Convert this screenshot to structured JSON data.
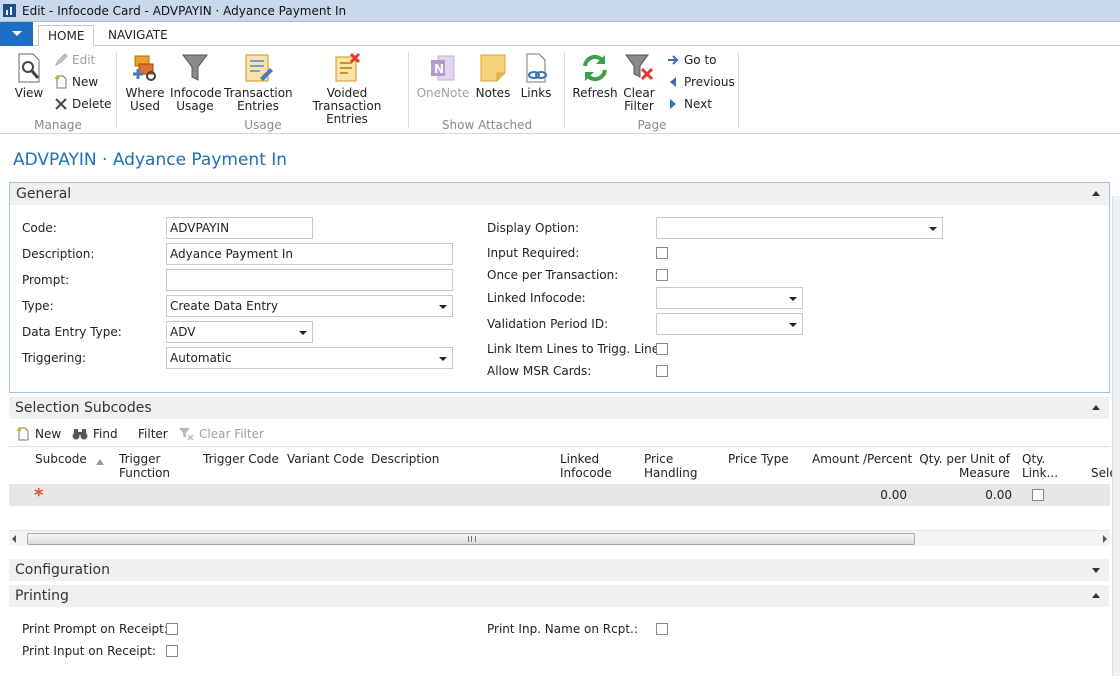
{
  "window": {
    "title": "Edit - Infocode Card - ADVPAYIN · Adyance Payment In"
  },
  "ribbon": {
    "tabs": [
      {
        "label": "HOME"
      },
      {
        "label": "NAVIGATE"
      }
    ],
    "manage": {
      "label": "Manage",
      "view": "View",
      "edit": "Edit",
      "new": "New",
      "delete": "Delete"
    },
    "usage": {
      "label": "Usage",
      "where_used_1": "Where",
      "where_used_2": "Used",
      "infocode_usage_1": "Infocode",
      "infocode_usage_2": "Usage",
      "transaction_entries_1": "Transaction",
      "transaction_entries_2": "Entries",
      "voided_1": "Voided",
      "voided_2": "Transaction Entries"
    },
    "show_attached": {
      "label": "Show Attached",
      "onenote": "OneNote",
      "notes": "Notes",
      "links": "Links"
    },
    "page": {
      "label": "Page",
      "refresh": "Refresh",
      "clear_filter_1": "Clear",
      "clear_filter_2": "Filter",
      "go_to": "Go to",
      "previous": "Previous",
      "next": "Next"
    }
  },
  "page_title": "ADVPAYIN · Adyance Payment In",
  "general": {
    "title": "General",
    "code": {
      "label": "Code:",
      "value": "ADVPAYIN"
    },
    "description": {
      "label": "Description:",
      "value": "Adyance Payment In"
    },
    "prompt": {
      "label": "Prompt:",
      "value": ""
    },
    "type": {
      "label": "Type:",
      "value": "Create Data Entry"
    },
    "data_entry_type": {
      "label": "Data Entry Type:",
      "value": "ADV"
    },
    "triggering": {
      "label": "Triggering:",
      "value": "Automatic"
    },
    "display_option": {
      "label": "Display Option:",
      "value": ""
    },
    "input_required": {
      "label": "Input Required:",
      "checked": false
    },
    "once_per_transaction": {
      "label": "Once per Transaction:",
      "checked": false
    },
    "linked_infocode": {
      "label": "Linked Infocode:",
      "value": ""
    },
    "validation_period_id": {
      "label": "Validation Period ID:",
      "value": ""
    },
    "link_item_lines": {
      "label": "Link Item Lines to Trigg. Line:",
      "checked": false
    },
    "allow_msr_cards": {
      "label": "Allow MSR Cards:",
      "checked": false
    }
  },
  "selection_subcodes": {
    "title": "Selection Subcodes",
    "toolbar": {
      "new": "New",
      "find": "Find",
      "filter": "Filter",
      "clear_filter": "Clear Filter"
    },
    "columns": {
      "subcode": "Subcode",
      "trigger_function_1": "Trigger",
      "trigger_function_2": "Function",
      "trigger_code": "Trigger Code",
      "variant_code": "Variant Code",
      "description": "Description",
      "linked_infocode_1": "Linked",
      "linked_infocode_2": "Infocode",
      "price_handling_1": "Price",
      "price_handling_2": "Handling",
      "price_type": "Price Type",
      "amount_percent": "Amount /Percent",
      "qty_per_unit_1": "Qty. per Unit of",
      "qty_per_unit_2": "Measure",
      "qty_link_1": "Qty.",
      "qty_link_2": "Link...",
      "sel": "Sele"
    },
    "new_row": {
      "marker": "*",
      "amount_percent": "0.00",
      "qty_per_unit": "0.00"
    }
  },
  "configuration": {
    "title": "Configuration"
  },
  "printing": {
    "title": "Printing",
    "print_prompt": {
      "label": "Print Prompt on Receipt:",
      "checked": false
    },
    "print_input": {
      "label": "Print Input on Receipt:",
      "checked": false
    },
    "print_inp_name": {
      "label": "Print Inp. Name on Rcpt.:",
      "checked": false
    }
  },
  "colors": {
    "accent": "#1e6fb5",
    "app_menu": "#1e6fc4",
    "title_bar": "#c9d9ec",
    "new_marker": "#e04c2c"
  }
}
